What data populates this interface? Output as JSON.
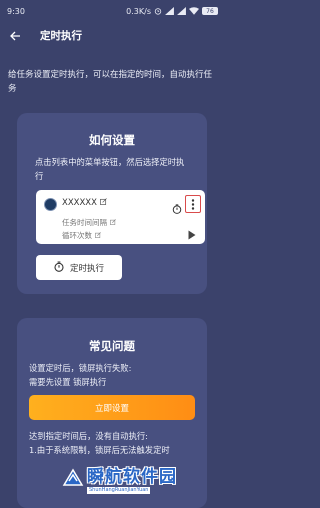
{
  "status_bar": {
    "time": "9:30",
    "network_speed": "0.3K/s",
    "battery": "76"
  },
  "header": {
    "title": "定时执行"
  },
  "intro": {
    "text": "给任务设置定时执行，可以在指定的时间，自动执行任务"
  },
  "how_to": {
    "title": "如何设置",
    "description": "点击列表中的菜单按钮，然后选择定时执行",
    "example_task": {
      "name": "XXXXXX",
      "interval_label": "任务时间间隔",
      "loop_label": "循环次数"
    },
    "timer_button_label": "定时执行"
  },
  "faq": {
    "title": "常见问题",
    "q1_line1": "设置定时后，锁屏执行失败:",
    "q1_line2": "需要先设置 锁屏执行",
    "setup_button_label": "立即设置",
    "q2_line1": "达到指定时间后，没有自动执行:",
    "q2_line2": "1.由于系统限制，锁屏后无法触发定时"
  },
  "watermark": {
    "main": "瞬航软件园",
    "sub": "ShunHangRuanJianYuan"
  },
  "colors": {
    "background": "#3b426b",
    "card": "#485080",
    "accent_orange": "#ff9c18",
    "highlight_red": "#d94b4b",
    "watermark_blue": "#2a67c6"
  },
  "icons": {
    "back": "arrow-left-icon",
    "timer": "stopwatch-icon",
    "menu": "vertical-dots-icon",
    "play": "play-icon",
    "edit": "edit-icon"
  }
}
